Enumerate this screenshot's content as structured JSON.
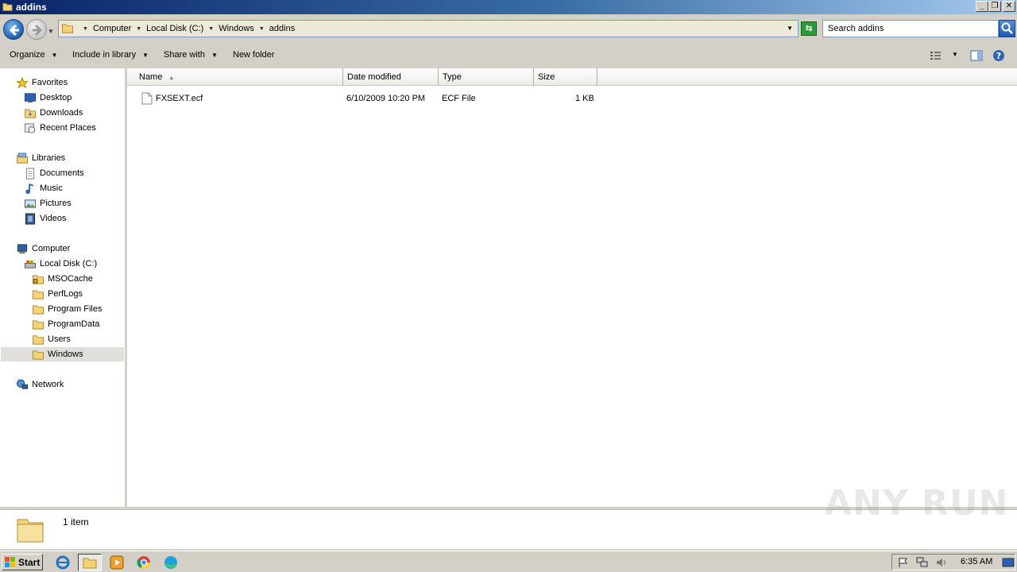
{
  "window": {
    "title": "addins"
  },
  "address": {
    "crumbs": [
      "Computer",
      "Local Disk (C:)",
      "Windows",
      "addins"
    ],
    "search_placeholder": "Search addins"
  },
  "toolbar": {
    "organize": "Organize",
    "include_in_library": "Include in library",
    "share_with": "Share with",
    "new_folder": "New folder"
  },
  "nav": {
    "favorites": "Favorites",
    "desktop": "Desktop",
    "downloads": "Downloads",
    "recent_places": "Recent Places",
    "libraries": "Libraries",
    "documents": "Documents",
    "music": "Music",
    "pictures": "Pictures",
    "videos": "Videos",
    "computer": "Computer",
    "local_disk": "Local Disk (C:)",
    "msocache": "MSOCache",
    "perflogs": "PerfLogs",
    "program_files": "Program Files",
    "programdata": "ProgramData",
    "users": "Users",
    "windows": "Windows",
    "network": "Network"
  },
  "columns": {
    "name": "Name",
    "date": "Date modified",
    "type": "Type",
    "size": "Size"
  },
  "files": [
    {
      "name": "FXSEXT.ecf",
      "date": "6/10/2009 10:20 PM",
      "type": "ECF File",
      "size": "1 KB"
    }
  ],
  "details": {
    "count": "1 item"
  },
  "watermark": "ANY RUN",
  "taskbar": {
    "start": "Start",
    "clock": "6:35 AM"
  }
}
